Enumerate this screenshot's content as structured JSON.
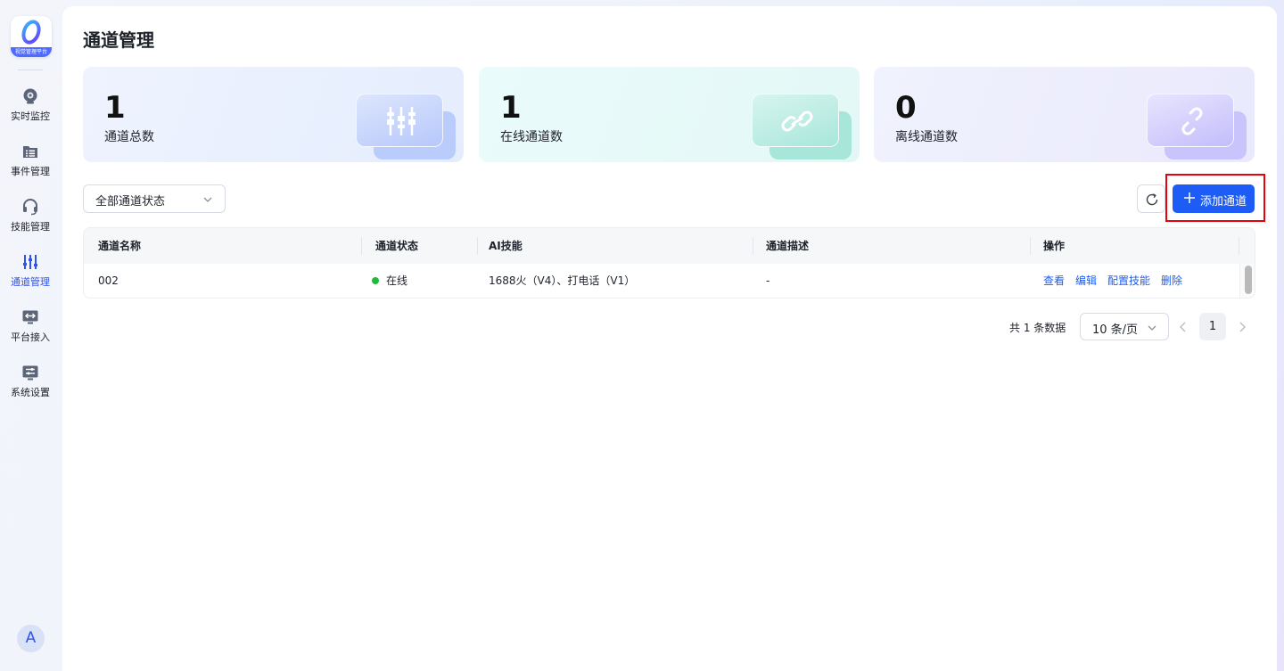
{
  "sidebar": {
    "logo_text": "视觉管理平台",
    "items": [
      {
        "label": "实时监控",
        "icon": "camera-icon",
        "active": false
      },
      {
        "label": "事件管理",
        "icon": "folder-list-icon",
        "active": false
      },
      {
        "label": "技能管理",
        "icon": "headset-icon",
        "active": false
      },
      {
        "label": "通道管理",
        "icon": "sliders-icon",
        "active": true
      },
      {
        "label": "平台接入",
        "icon": "monitor-arrow-icon",
        "active": false
      },
      {
        "label": "系统设置",
        "icon": "settings-panel-icon",
        "active": false
      }
    ],
    "avatar_initial": "A"
  },
  "page": {
    "title": "通道管理"
  },
  "stats": {
    "total": {
      "value": "1",
      "label": "通道总数",
      "icon": "sliders-icon"
    },
    "online": {
      "value": "1",
      "label": "在线通道数",
      "icon": "link-icon"
    },
    "offline": {
      "value": "0",
      "label": "离线通道数",
      "icon": "broken-link-icon"
    }
  },
  "toolbar": {
    "status_filter": "全部通道状态",
    "add_label": "添加通道"
  },
  "table": {
    "headers": [
      "通道名称",
      "通道状态",
      "AI技能",
      "通道描述",
      "操作"
    ],
    "rows": [
      {
        "name": "002",
        "status": "在线",
        "skills": "1688火（V4）、打电话（V1）",
        "description": "-",
        "actions": [
          "查看",
          "编辑",
          "配置技能",
          "删除"
        ]
      }
    ]
  },
  "pagination": {
    "total_text": "共 1 条数据",
    "page_size": "10 条/页",
    "current_page": "1"
  },
  "colors": {
    "primary": "#1d5cf5",
    "online_dot": "#1fbb3a",
    "highlight": "#e8000b"
  }
}
